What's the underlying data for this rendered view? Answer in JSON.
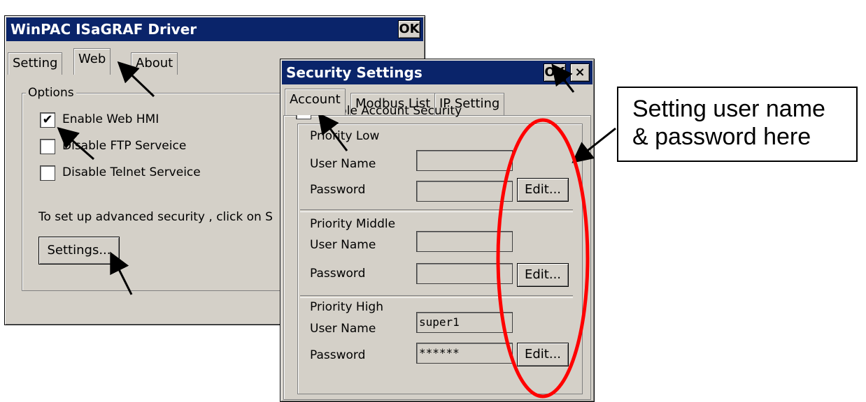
{
  "driver_window": {
    "title": "WinPAC ISaGRAF Driver",
    "ok_label": "OK",
    "tabs": [
      "Setting",
      "Web",
      "About"
    ],
    "options_group": "Options",
    "checkboxes": [
      {
        "label": "Enable Web HMI",
        "checked": true
      },
      {
        "label": "Disable FTP Serveice",
        "checked": false
      },
      {
        "label": "Disable Telnet Serveice",
        "checked": false
      }
    ],
    "hint": "To set up advanced security , click on S",
    "settings_button": "Settings..."
  },
  "security_window": {
    "title": "Security Settings",
    "ok_label": "OK",
    "close_glyph": "×",
    "tabs": [
      "Account",
      "Modbus List",
      "IP Setting"
    ],
    "enable_security": {
      "label": "Enable Account Security",
      "checked": true
    },
    "check_glyph": "✔",
    "user_name_label": "User Name",
    "password_label": "Password",
    "edit_label": "Edit...",
    "groups": [
      {
        "title": "Priority Low",
        "user_name": "",
        "password": ""
      },
      {
        "title": "Priority Middle",
        "user_name": "",
        "password": ""
      },
      {
        "title": "Priority High",
        "user_name": "super1",
        "password": "******"
      }
    ]
  },
  "callout": {
    "line1": "Setting user name",
    "line2": "& password here"
  },
  "colors": {
    "titlebar": "#0a246a",
    "window_face": "#d4d0c8",
    "highlight_ellipse": "#ff0000"
  }
}
